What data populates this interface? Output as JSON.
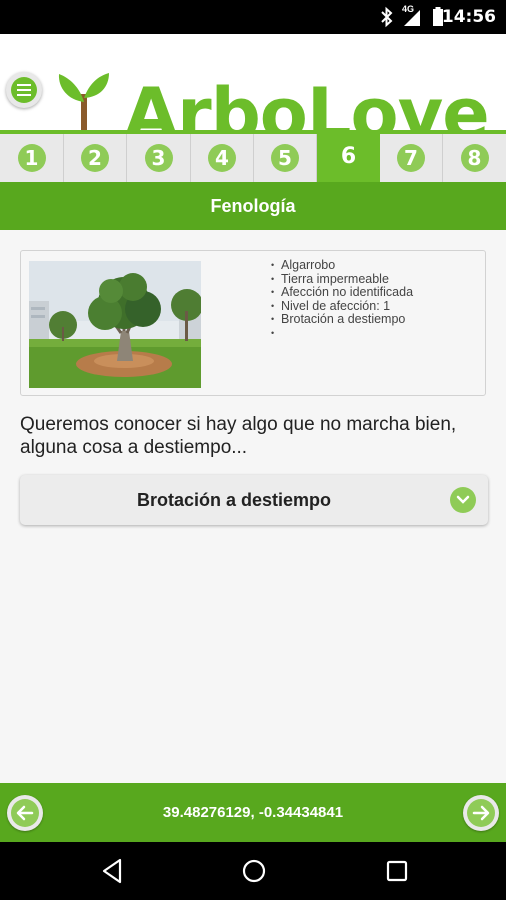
{
  "status_bar": {
    "time": "14:56",
    "network": "4G",
    "icons": [
      "bluetooth-icon",
      "signal-icon",
      "battery-icon"
    ]
  },
  "header": {
    "brand": "ArboLove",
    "menu_icon": "hamburger-icon",
    "logo_icon": "sprout-icon"
  },
  "steps": [
    {
      "label": "1",
      "active": false
    },
    {
      "label": "2",
      "active": false
    },
    {
      "label": "3",
      "active": false
    },
    {
      "label": "4",
      "active": false
    },
    {
      "label": "5",
      "active": false
    },
    {
      "label": "6",
      "active": true
    },
    {
      "label": "7",
      "active": false
    },
    {
      "label": "8",
      "active": false
    }
  ],
  "section_title": "Fenología",
  "tree_card": {
    "photo_icon": "tree-photo",
    "facts": [
      "Algarrobo",
      "Tierra impermeable",
      "Afección no identificada",
      "Nivel de afección: 1",
      "Brotación a destiempo",
      ""
    ]
  },
  "question": "Queremos conocer si hay algo que no marcha bien, alguna cosa a destiempo...",
  "dropdown": {
    "selected": "Brotación a destiempo",
    "icon": "chevron-down-icon"
  },
  "footer": {
    "coordinates": "39.48276129, -0.34434841",
    "prev_icon": "arrow-left-icon",
    "next_icon": "arrow-right-icon"
  },
  "colors": {
    "brand_green": "#6cbd2a",
    "dark_green": "#58a81e",
    "light_green": "#8fcb57"
  }
}
